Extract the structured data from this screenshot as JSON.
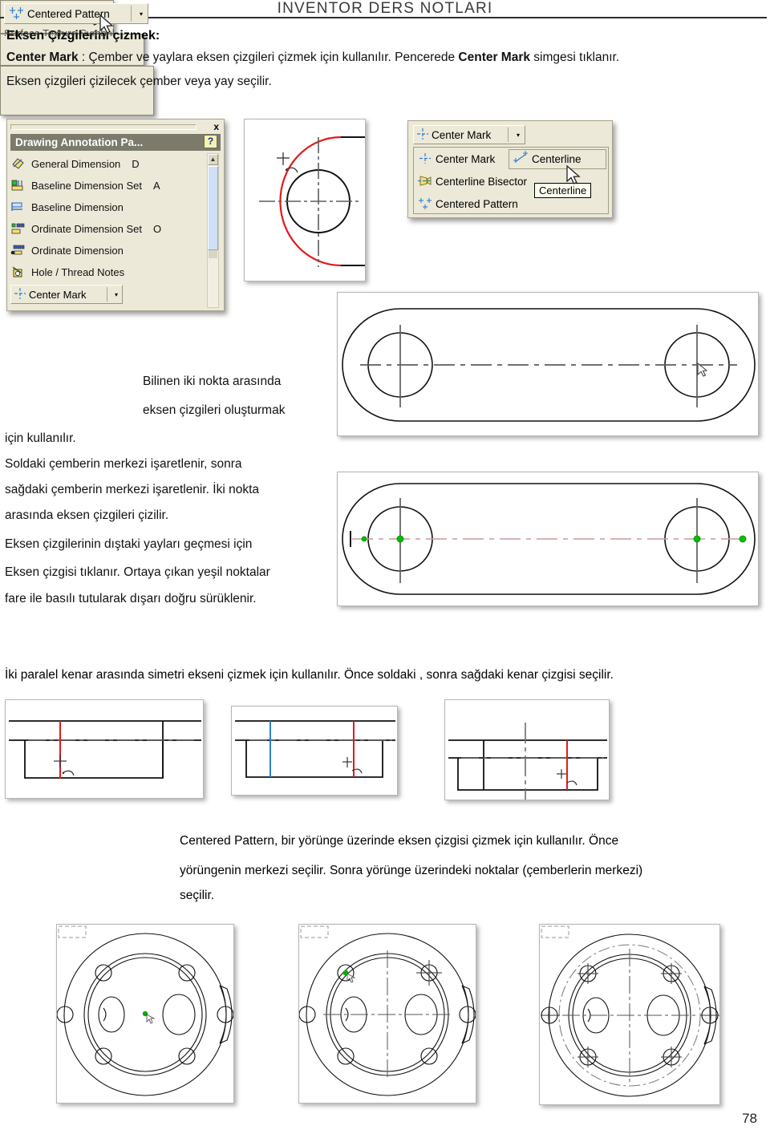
{
  "header": {
    "title": "INVENTOR DERS NOTLARI"
  },
  "headings": {
    "main": "Eksen Çizgilerini çizmek:"
  },
  "paragraphs": {
    "center_mark_line_a": "Center Mark",
    "center_mark_line_b": " : Çember ve yaylara eksen çizgileri çizmek için kullanılır. Pencerede ",
    "center_mark_line_c": "Center Mark",
    "center_mark_line_d": " simgesi tıklanır.",
    "select_circle": "Eksen çizgileri çizilecek çember veya yay seçilir.",
    "bilinen_1": "Bilinen iki nokta arasında",
    "bilinen_2": "eksen çizgileri oluşturmak",
    "icin_kullanilir": "için kullanılır.",
    "soldaki_1": "Soldaki çemberin merkezi işaretlenir, sonra",
    "soldaki_2": "sağdaki çemberin merkezi işaretlenir. İki nokta",
    "soldaki_3": "arasında eksen çizgileri çizilir.",
    "eksen_1": "Eksen çizgilerinin dıştaki yayları geçmesi için",
    "eksen_2": "Eksen çizgisi tıklanır. Ortaya çıkan yeşil noktalar",
    "eksen_3": "fare ile basılı tutularak dışarı doğru sürüklenir.",
    "bisector_desc": "İki paralel kenar arasında simetri ekseni çizmek için kullanılır. Önce soldaki , sonra sağdaki kenar çizgisi seçilir.",
    "pattern_1": "Centered Pattern, bir yörünge üzerinde eksen çizgisi çizmek için kullanılır. Önce",
    "pattern_2": "yörüngenin merkezi seçilir. Sonra yörünge üzerindeki noktalar (çemberlerin merkezi)",
    "pattern_3": "seçilir."
  },
  "annotation_panel": {
    "title": "Drawing Annotation Pa...",
    "close_label": "x",
    "help_label": "?",
    "caret": "▼",
    "items": [
      {
        "label": "General Dimension",
        "key": "D",
        "icon": "general-dimension-icon"
      },
      {
        "label": "Baseline Dimension Set",
        "key": "A",
        "icon": "baseline-dimension-set-icon"
      },
      {
        "label": "Baseline Dimension",
        "key": "",
        "icon": "baseline-dimension-icon"
      },
      {
        "label": "Ordinate Dimension Set",
        "key": "O",
        "icon": "ordinate-dimension-set-icon"
      },
      {
        "label": "Ordinate Dimension",
        "key": "",
        "icon": "ordinate-dimension-icon"
      },
      {
        "label": "Hole / Thread Notes",
        "key": "",
        "icon": "hole-thread-notes-icon"
      }
    ],
    "bottom_button": {
      "label": "Center Mark",
      "caret": "▾",
      "icon": "center-mark-icon"
    },
    "scroll_up_glyph": "▲"
  },
  "centermark_flyout": {
    "top_button": {
      "label": "Center Mark",
      "caret": "▾",
      "icon": "center-mark-icon"
    },
    "menu_items": [
      {
        "label": "Center Mark",
        "icon": "center-mark-icon"
      },
      {
        "label": "Centerline Bisector",
        "icon": "centerline-bisector-icon"
      },
      {
        "label": "Centered Pattern",
        "icon": "centered-pattern-icon"
      }
    ],
    "highlighted_item": {
      "label": "Centerline",
      "icon": "centerline-icon"
    },
    "tooltip": "Centerline"
  },
  "centerline_button": {
    "label": "Centerline",
    "caret": "▾",
    "icon": "centerline-icon"
  },
  "bisector_button": {
    "label": "Centerline Bisector",
    "icon": "centerline-bisector-icon"
  },
  "pattern_button": {
    "label": "Centered Pattern",
    "caret": "▾",
    "icon": "centered-pattern-icon",
    "ghost_label": "Surface Texture Symbol"
  },
  "footer": {
    "page_number": "78"
  },
  "colors": {
    "chrome": "#ece9d8",
    "titlebar": "#7b7a6b",
    "icon_blue": "#3a7bd5",
    "icon_yellow": "#f2d23a",
    "icon_green": "#00b000",
    "cad_red": "#e01b1b",
    "cad_blue": "#2d7fd0",
    "cad_green": "#00c000",
    "cad_line": "#1a1a1a",
    "centerline_gray": "#6e6e6e"
  },
  "cad_figures": [
    {
      "name": "center-mark-circle-arc",
      "caption": ""
    },
    {
      "name": "centerline-two-holes",
      "caption": ""
    },
    {
      "name": "centerline-green-handles",
      "caption": ""
    },
    {
      "name": "bisector-step-1",
      "caption": ""
    },
    {
      "name": "bisector-step-2",
      "caption": ""
    },
    {
      "name": "bisector-step-3",
      "caption": ""
    },
    {
      "name": "flange-pattern-step-1",
      "caption": ""
    },
    {
      "name": "flange-pattern-step-2",
      "caption": ""
    },
    {
      "name": "flange-pattern-step-3",
      "caption": ""
    }
  ]
}
